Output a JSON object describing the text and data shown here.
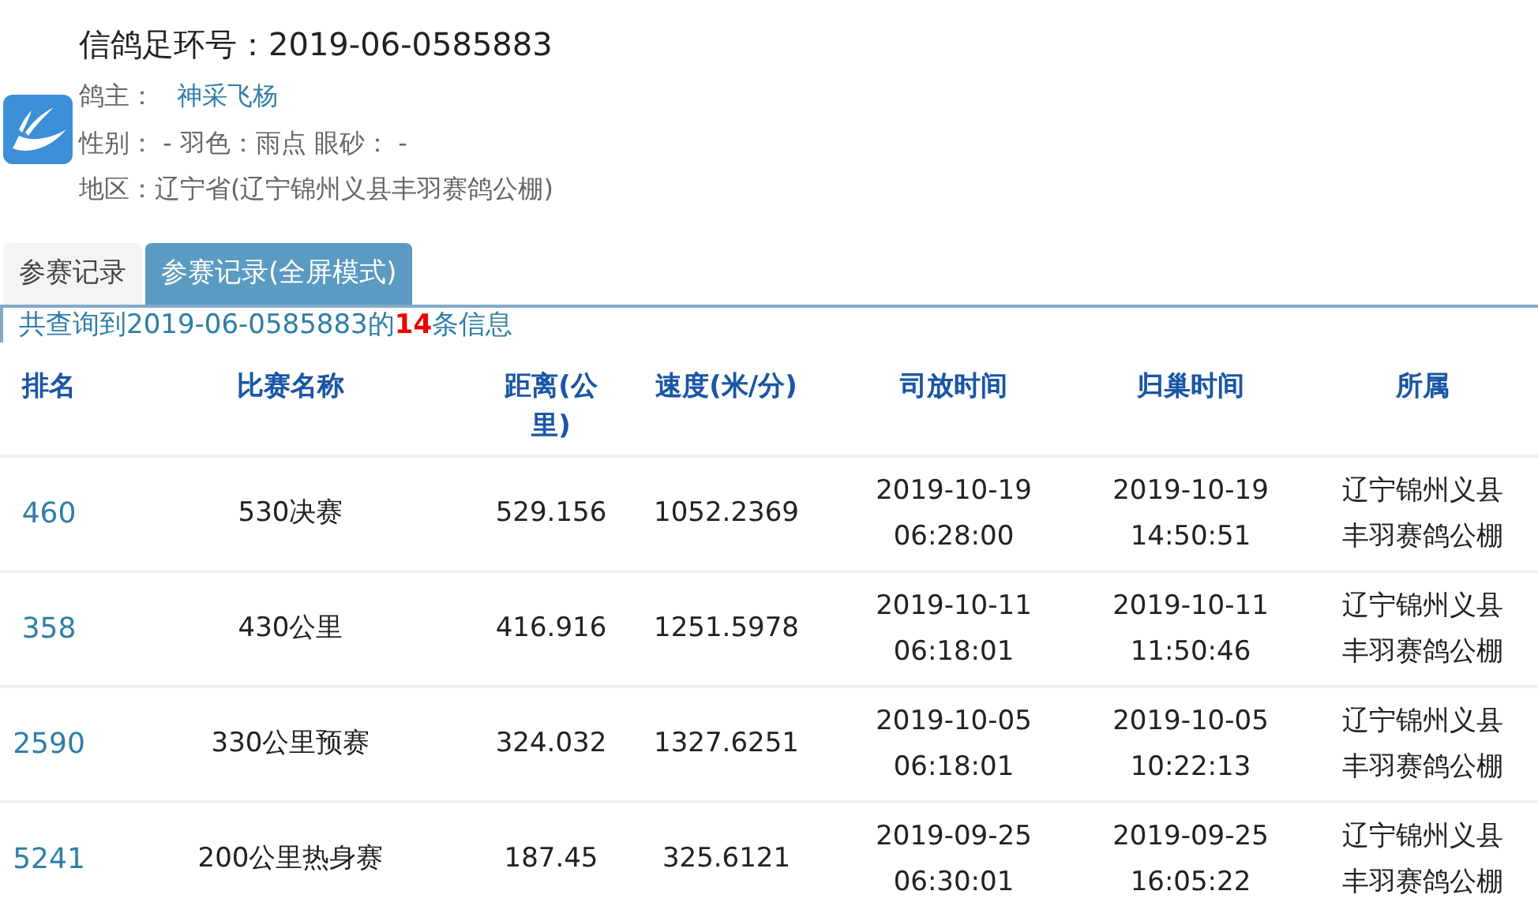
{
  "ring": {
    "label": "信鸽足环号：",
    "number": "2019-06-0585883"
  },
  "owner": {
    "label": "鸽主：",
    "name": "神采飞杨"
  },
  "details": "性别： - 羽色：雨点 眼砂： -",
  "region": "地区：辽宁省(辽宁锦州义县丰羽赛鸽公棚)",
  "tabs": [
    {
      "label": "参赛记录",
      "selected": false
    },
    {
      "label": "参赛记录(全屏模式)",
      "selected": true
    }
  ],
  "summary": "共查询到2019-06-0585883的**14**条信息",
  "table": {
    "columns": [
      "排名",
      "比赛名称",
      "距离(公里)",
      "速度(米/分)",
      "司放时间",
      "归巢时间",
      "所属"
    ],
    "rows": [
      [
        "460",
        "530决赛",
        "529.156",
        "1052.2369",
        "2019-10-19 06:28:00",
        "2019-10-19 14:50:51",
        "辽宁锦州义县丰羽赛鸽公棚"
      ],
      [
        "358",
        "430公里",
        "416.916",
        "1251.5978",
        "2019-10-11 06:18:01",
        "2019-10-11 11:50:46",
        "辽宁锦州义县丰羽赛鸽公棚"
      ],
      [
        "2590",
        "330公里预赛",
        "324.032",
        "1327.6251",
        "2019-10-05 06:18:01",
        "2019-10-05 10:22:13",
        "辽宁锦州义县丰羽赛鸽公棚"
      ],
      [
        "5241",
        "200公里热身赛",
        "187.45",
        "325.6121",
        "2019-09-25 06:30:01",
        "2019-09-25 16:05:22",
        "辽宁锦州义县丰羽赛鸽公棚"
      ]
    ]
  }
}
